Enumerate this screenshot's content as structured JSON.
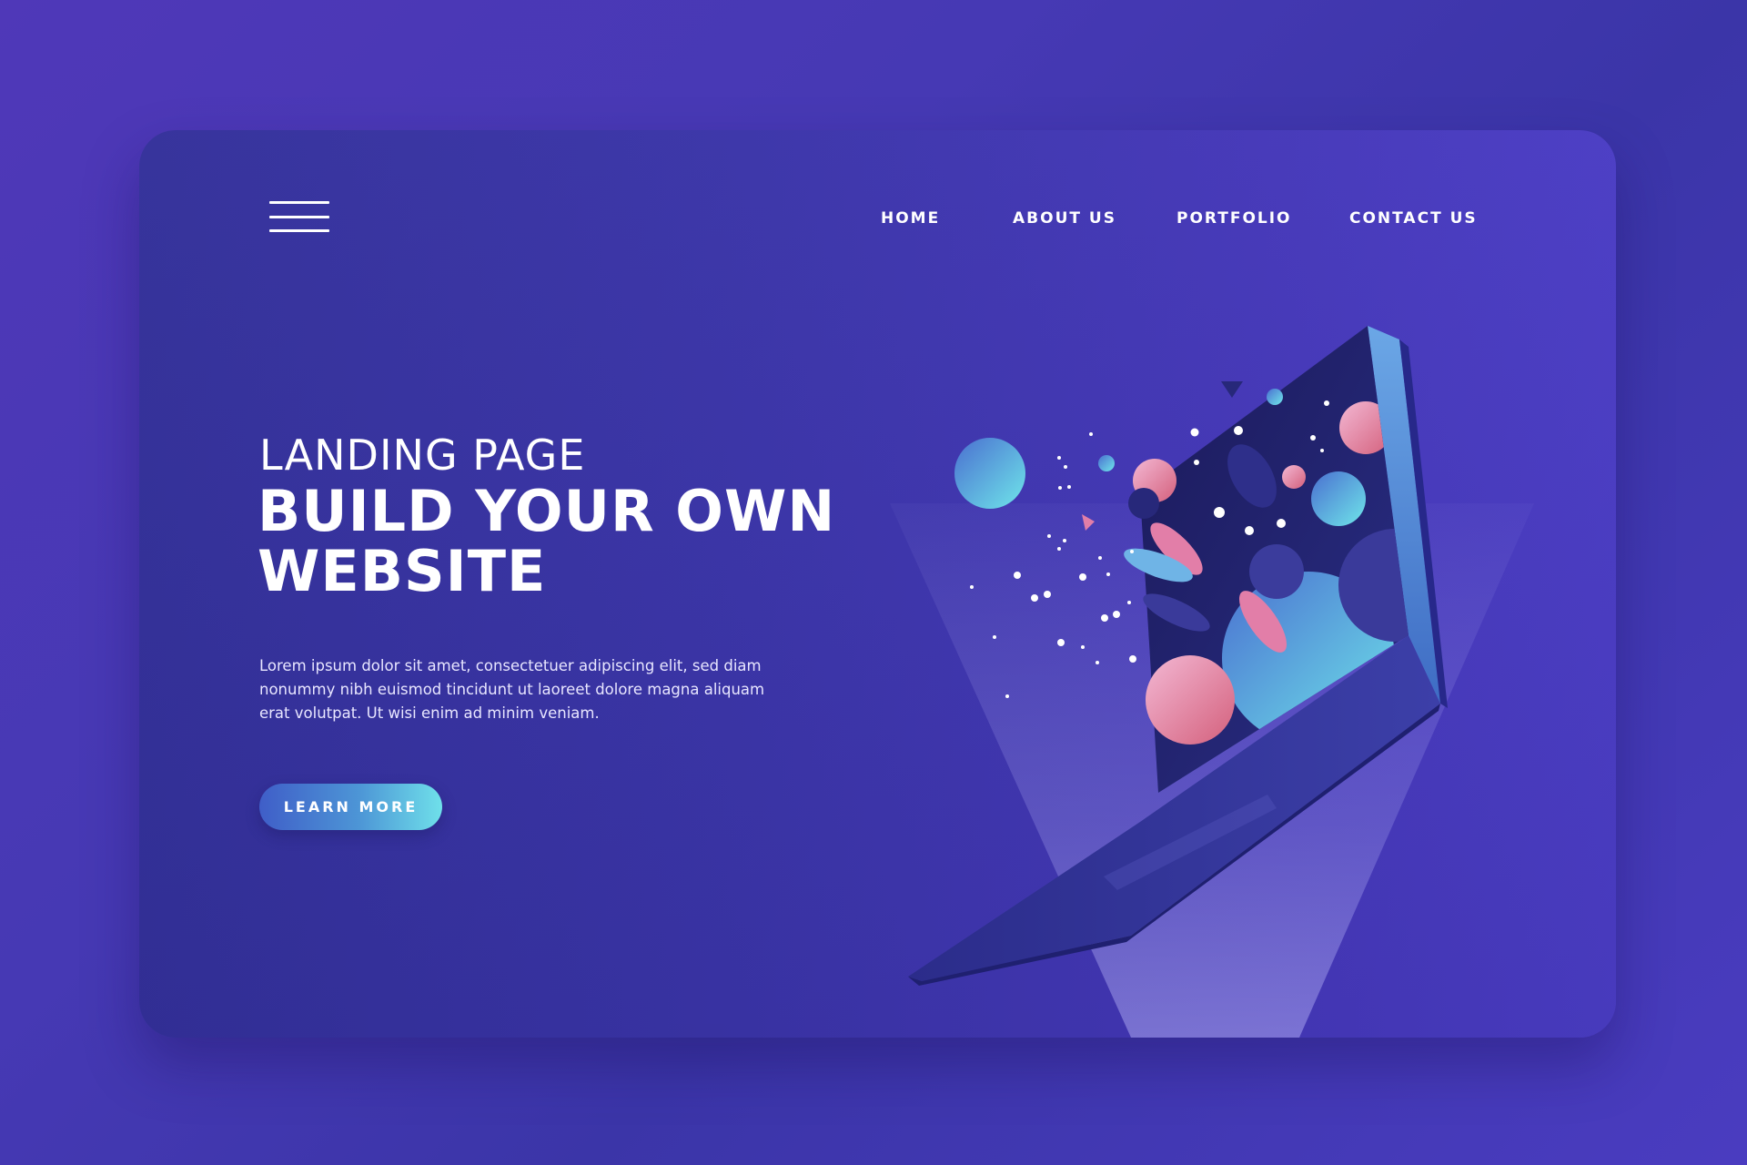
{
  "nav": {
    "menu_icon": "hamburger-menu-icon",
    "items": [
      {
        "label": "HOME"
      },
      {
        "label": "ABOUT US"
      },
      {
        "label": "PORTFOLIO"
      },
      {
        "label": "CONTACT US"
      }
    ]
  },
  "hero": {
    "eyebrow": "LANDING PAGE",
    "headline_line1": "BUILD YOUR OWN",
    "headline_line2": "WEBSITE",
    "body": "Lorem ipsum dolor sit amet, consectetuer adipiscing elit, sed diam nonummy nibh euismod tincidunt ut laoreet dolore magna aliquam erat volutpat. Ut wisi enim ad minim veniam.",
    "cta_label": "LEARN MORE"
  },
  "illustration": {
    "subject": "laptop-icon",
    "colors": {
      "screen": "#181a5e",
      "pink": "#e27ea8",
      "cyan": "#6fe0ea",
      "blue": "#4a7fd6",
      "light_beam": "#a9a6f0"
    }
  },
  "colors": {
    "background": "#4639b4",
    "card": "#3a34a8",
    "text": "#ffffff",
    "button_start": "#3f5ec8",
    "button_end": "#6fe0ea"
  }
}
